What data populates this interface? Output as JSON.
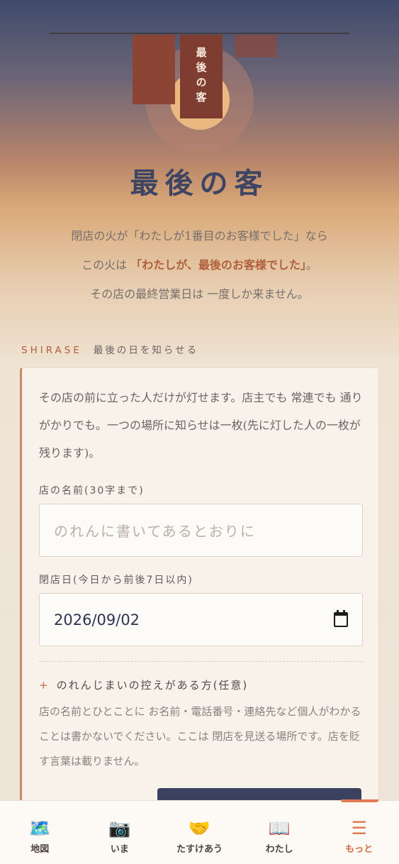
{
  "hero": {
    "noren_text": "最後の客",
    "title": "最後の客",
    "intro": {
      "line1": "閉店の火が「わたしが1番目のお客様でした」なら",
      "line2_pre": "この火は",
      "line2_em": "「わたしが、最後のお客様でした」",
      "line2_post": "。",
      "line3": "その店の最終営業日は 一度しか来ません。"
    }
  },
  "section": {
    "label_en": "SHIRASE",
    "label_jp": "最後の日を知らせる"
  },
  "form": {
    "description": "その店の前に立った人だけが灯せます。店主でも 常連でも 通りがかりでも。一つの場所に知らせは一枚(先に灯した人の一枚が残ります)。",
    "name_label": "店の名前(30字まで)",
    "name_placeholder": "のれんに書いてあるとおりに",
    "date_label": "閉店日(今日から前後7日以内)",
    "date_value": "2026/09/02",
    "optional_toggle_symbol": "+",
    "optional_toggle_label": "のれんじまいの控えがある方(任意)",
    "note": "店の名前とひとことに お名前・電話番号・連絡先など個人がわかることは書かないでください。ここは 閉店を見送る場所です。店を貶す言葉は載りません。"
  },
  "tabbar": {
    "tabs": [
      {
        "label": "地図",
        "icon": "🗺️"
      },
      {
        "label": "いま",
        "icon": "📷"
      },
      {
        "label": "たすけあう",
        "icon": "🤝"
      },
      {
        "label": "わたし",
        "icon": "📖"
      },
      {
        "label": "もっと",
        "icon": "☰"
      }
    ]
  }
}
